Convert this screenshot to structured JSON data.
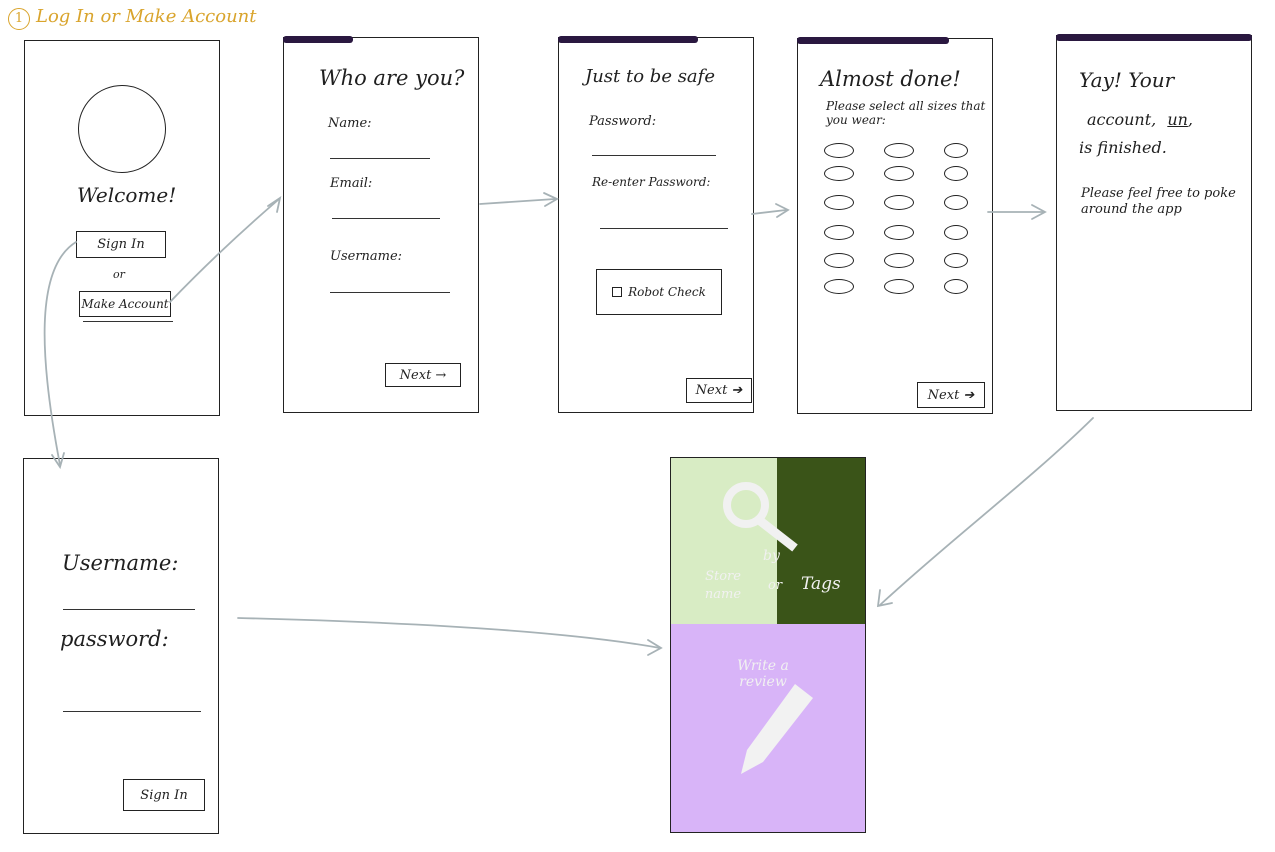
{
  "section_title": {
    "number": "1",
    "text": "Log In or Make Account"
  },
  "welcome": {
    "heading": "Welcome!",
    "sign_in_button": "Sign In",
    "or_text": "or",
    "make_account_button": "Make Account"
  },
  "who": {
    "heading": "Who are you?",
    "name_label": "Name:",
    "email_label": "Email:",
    "username_label": "Username:",
    "next_button": "Next →"
  },
  "safe": {
    "heading": "Just to be safe",
    "password_label": "Password:",
    "reenter_label": "Re-enter Password:",
    "robot_check": "Robot Check",
    "next_button": "Next ➔"
  },
  "almost": {
    "heading": "Almost done!",
    "subheading": "Please select all sizes that you wear:",
    "size_options_count": 18,
    "next_button": "Next ➔"
  },
  "finished": {
    "line1": "Yay! Your",
    "line2_prefix": "account,",
    "line2_username": "un",
    "line2_suffix": ",",
    "line3": "is finished.",
    "note": "Please feel free to poke around the app"
  },
  "signin": {
    "username_label": "Username:",
    "password_label": "password:",
    "sign_in_button": "Sign In"
  },
  "home": {
    "search_by": "by",
    "store_name": "Store name",
    "or_text": "or",
    "tags": "Tags",
    "write_review": "Write a review",
    "colors": {
      "light_green": "#d8ecc4",
      "dark_green": "#3a5418",
      "purple": "#d8b4f8"
    }
  },
  "colors": {
    "progress": "#2a1840",
    "title_accent": "#d9a42c",
    "arrow": "#a7b2b6"
  }
}
